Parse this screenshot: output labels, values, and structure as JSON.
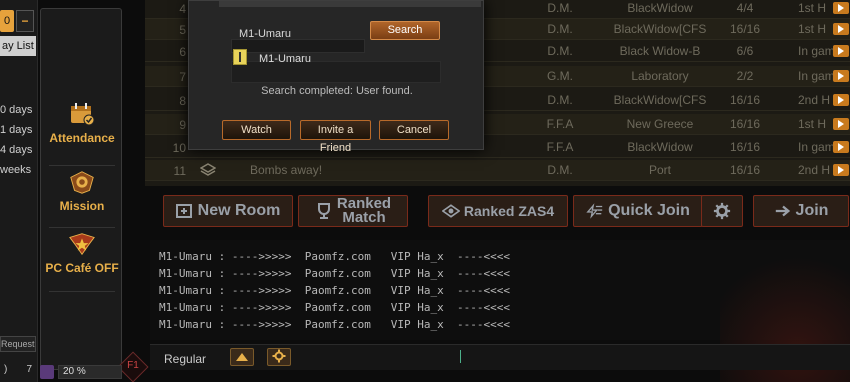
{
  "left_panel": {
    "top_value": "0",
    "minus_label": "−",
    "day_list_label": "ay List",
    "days": [
      "0 days",
      "1 days",
      "4 days",
      "weeks"
    ],
    "request_label": "Request",
    "bottom_left": ")",
    "bottom_right": "7"
  },
  "side_menu": {
    "items": [
      {
        "label": "Attendance",
        "icon": "calendar-icon"
      },
      {
        "label": "Mission",
        "icon": "mission-emblem-icon"
      },
      {
        "label": "PC Café OFF",
        "icon": "pc-cafe-emblem-icon"
      }
    ],
    "f1_label": "F1",
    "zoom_value": "20 %"
  },
  "room_list": {
    "rows": [
      {
        "num": "4",
        "name": "",
        "mode": "D.M.",
        "map": "BlackWidow",
        "slots": "4/4",
        "state": "1st H",
        "play": true
      },
      {
        "num": "5",
        "name": "",
        "mode": "D.M.",
        "map": "BlackWidow[CFS",
        "slots": "16/16",
        "state": "1st H",
        "play": true
      },
      {
        "num": "6",
        "name": "",
        "mode": "D.M.",
        "map": "Black Widow-B",
        "slots": "6/6",
        "state": "In gam",
        "play": true
      },
      {
        "num": "7",
        "name": "",
        "mode": "G.M.",
        "map": "Laboratory",
        "slots": "2/2",
        "state": "In game",
        "play": true
      },
      {
        "num": "8",
        "name": "",
        "mode": "D.M.",
        "map": "BlackWidow[CFS",
        "slots": "16/16",
        "state": "2nd H",
        "play": true
      },
      {
        "num": "9",
        "name": "",
        "mode": "F.F.A",
        "map": "New Greece",
        "slots": "16/16",
        "state": "1st H",
        "play": true
      },
      {
        "num": "10",
        "name": "",
        "mode": "F.F.A",
        "map": "BlackWidow",
        "slots": "16/16",
        "state": "In gam",
        "play": true
      },
      {
        "num": "11",
        "name": "Bombs away!",
        "mode": "D.M.",
        "map": "Port",
        "slots": "16/16",
        "state": "2nd H",
        "play": true
      }
    ]
  },
  "search_dialog": {
    "query_label": "M1-Umaru",
    "search_button": "Search",
    "result_name": "M1-Umaru",
    "status": "Search completed: User found.",
    "buttons": {
      "watch": "Watch",
      "invite": "Invite a Friend",
      "cancel": "Cancel"
    }
  },
  "actions": {
    "new_room": "New Room",
    "ranked_match_1": "Ranked",
    "ranked_match_2": "Match",
    "ranked_zas": "Ranked ZAS4",
    "quick_join": "Quick Join",
    "join": "Join"
  },
  "chat": {
    "lines": [
      "M1-Umaru : ---->>>>>  Paomfz.com   VIP Ha_x  ----<<<<",
      "M1-Umaru : ---->>>>>  Paomfz.com   VIP Ha_x  ----<<<<",
      "M1-Umaru : ---->>>>>  Paomfz.com   VIP Ha_x  ----<<<<",
      "M1-Umaru : ---->>>>>  Paomfz.com   VIP Ha_x  ----<<<<",
      "M1-Umaru : ---->>>>>  Paomfz.com   VIP Ha_x  ----<<<<"
    ],
    "channel": "Regular"
  },
  "colors": {
    "accent": "#e8b04a",
    "button_border": "#7a2a1a",
    "play": "#c87a1e"
  }
}
